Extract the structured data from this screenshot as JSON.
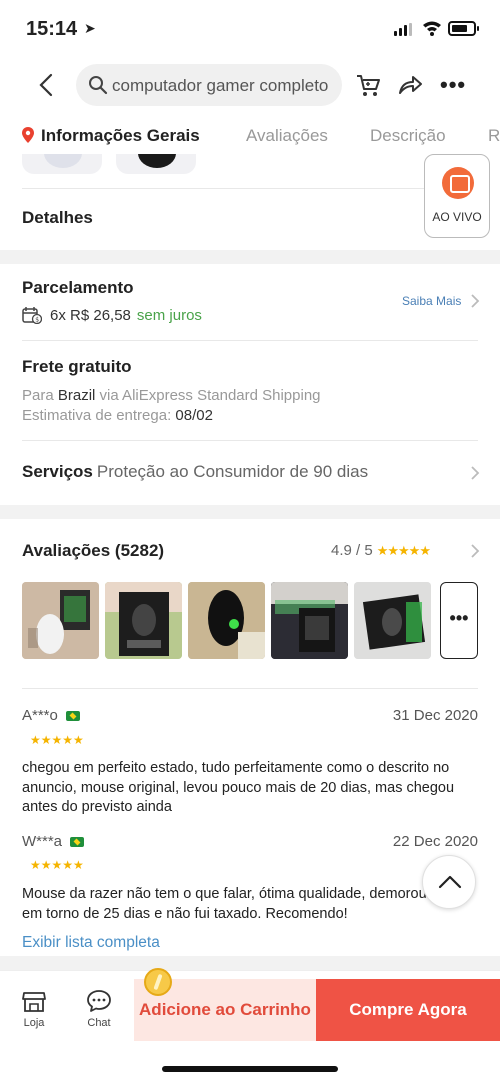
{
  "status": {
    "time": "15:14"
  },
  "header": {
    "search_text": "computador gamer completo"
  },
  "tabs": [
    "Informações Gerais",
    "Avaliações",
    "Descrição",
    "R"
  ],
  "details_label": "Detalhes",
  "live_label": "AO VIVO",
  "installments": {
    "title": "Parcelamento",
    "text": "6x R$ 26,58",
    "interest": "sem juros",
    "more": "Saiba Mais"
  },
  "shipping": {
    "title": "Frete gratuito",
    "to_prefix": "Para",
    "country": "Brazil",
    "via": "via AliExpress Standard Shipping",
    "estimate_label": "Estimativa de entrega:",
    "estimate_date": "08/02"
  },
  "services": {
    "label": "Serviços",
    "value": "Proteção ao Consumidor de 90 dias"
  },
  "reviews": {
    "title": "Avaliações (5282)",
    "score": "4.9 / 5",
    "stars": "★★★★★",
    "items": [
      {
        "user": "A***o",
        "date": "31 Dec 2020",
        "stars": "★★★★★",
        "text": "chegou em perfeito estado, tudo perfeitamente como o descrito no anuncio, mouse original, levou pouco mais de 20 dias, mas chegou antes do previsto ainda"
      },
      {
        "user": "W***a",
        "date": "22 Dec 2020",
        "stars": "★★★★★",
        "text": "Mouse da razer não tem o que falar, ótima qualidade, demorou em torno de 25 dias e não fui taxado. Recomendo!"
      }
    ],
    "more_symbol": "•••",
    "show_all": "Exibir lista completa"
  },
  "bottom": {
    "store": "Loja",
    "chat": "Chat",
    "add_cart": "Adicione ao Carrinho",
    "buy_now": "Compre Agora"
  },
  "colors": {
    "accent": "#ef5345",
    "accent_light": "#fde7e2",
    "link": "#4a8fc6",
    "star": "#f5b400",
    "ok": "#4aa34a"
  }
}
